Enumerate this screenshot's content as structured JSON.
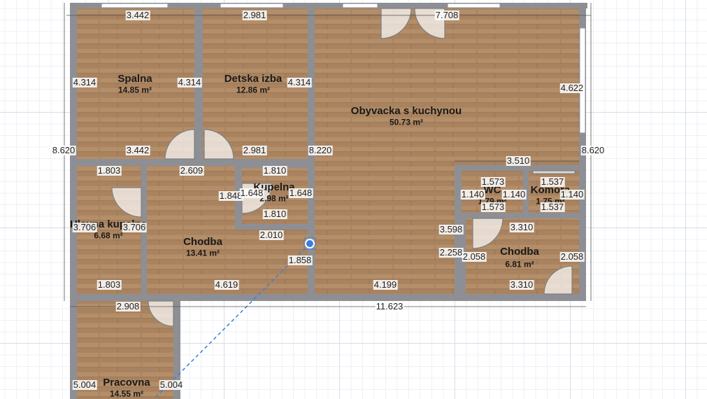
{
  "colors": {
    "wall": "#8d8f94",
    "floor": "#b08a64",
    "selection": "#3b7ddd",
    "background": "#ffffff"
  },
  "rooms": [
    {
      "name": "Spalna",
      "area": "14.85 m²"
    },
    {
      "name": "Detska izba",
      "area": "12.86 m²"
    },
    {
      "name": "Obyvacka s kuchynou",
      "area": "50.73 m²"
    },
    {
      "name": "Kupelna",
      "area": "2.98 m²"
    },
    {
      "name": "Hlavna kupelna",
      "area": "6.68 m²"
    },
    {
      "name": "Chodba",
      "area": "13.41 m²"
    },
    {
      "name": "WC",
      "area": "1.79 m²"
    },
    {
      "name": "Komora",
      "area": "1.75 m²"
    },
    {
      "name": "Chodba",
      "area": "6.81 m²"
    },
    {
      "name": "Pracovna",
      "area": "14.55 m²"
    }
  ],
  "dimensions": {
    "spalna_top": "3.442",
    "detska_top": "2.981",
    "obyvacka_top": "7.708",
    "spalna_left": "4.314",
    "spalna_right": "4.314",
    "detska_right": "4.314",
    "obyvacka_right": "4.622",
    "outer_left": "8.620",
    "outer_right": "8.620",
    "spalna_bottom": "3.442",
    "detska_bottom": "2.981",
    "inner_wall": "8.220",
    "store_top": "3.510",
    "hk_top": "1.803",
    "chodba_top": "2.609",
    "kup_top": "1.810",
    "kup_left": "1.848",
    "kup_in_left": "1.648",
    "kup_in_right": "1.648",
    "kup_bottom": "1.810",
    "wc_top": "1.573",
    "wc_left": "1.140",
    "wc_right": "1.140",
    "wc_bottom": "1.573",
    "kom_top": "1.537",
    "kom_right": "1.140",
    "kom_bottom": "1.537",
    "hk_left": "3.706",
    "hk_right": "3.706",
    "chodba_mid": "2.010",
    "chodba_right": "1.858",
    "ch2_left_outer": "3.598",
    "ch2_top": "3.310",
    "ch2_left": "2.258",
    "ch2_left_in": "2.058",
    "ch2_right": "2.058",
    "hk_bottom": "1.803",
    "chodba_bottom": "4.619",
    "obyv_bottom": "4.199",
    "ch2_bottom": "3.310",
    "overall_bottom": "11.623",
    "prac_top": "2.908",
    "prac_left": "5.004",
    "prac_right": "5.004"
  }
}
